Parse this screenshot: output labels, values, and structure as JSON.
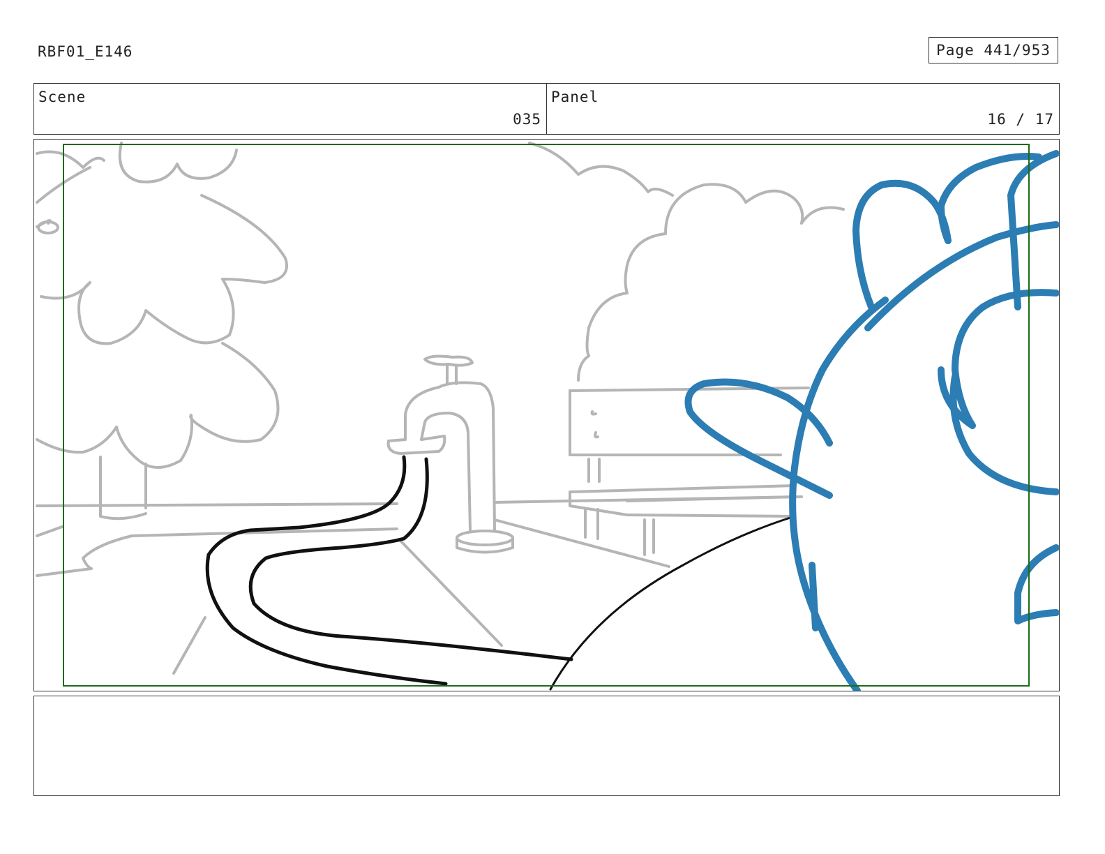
{
  "header": {
    "doc_id": "RBF01_E146",
    "page_label": "Page 441/953"
  },
  "info": {
    "scene_label": "Scene",
    "scene_value": "035",
    "panel_label": "Panel",
    "panel_value": "16 / 17"
  },
  "frame": {
    "safe_area_color": "#1a6b1a",
    "sketch_color": "#b5b5b5",
    "ink_color": "#111111",
    "character_color": "#2b7db3"
  },
  "notes": {
    "text": ""
  }
}
